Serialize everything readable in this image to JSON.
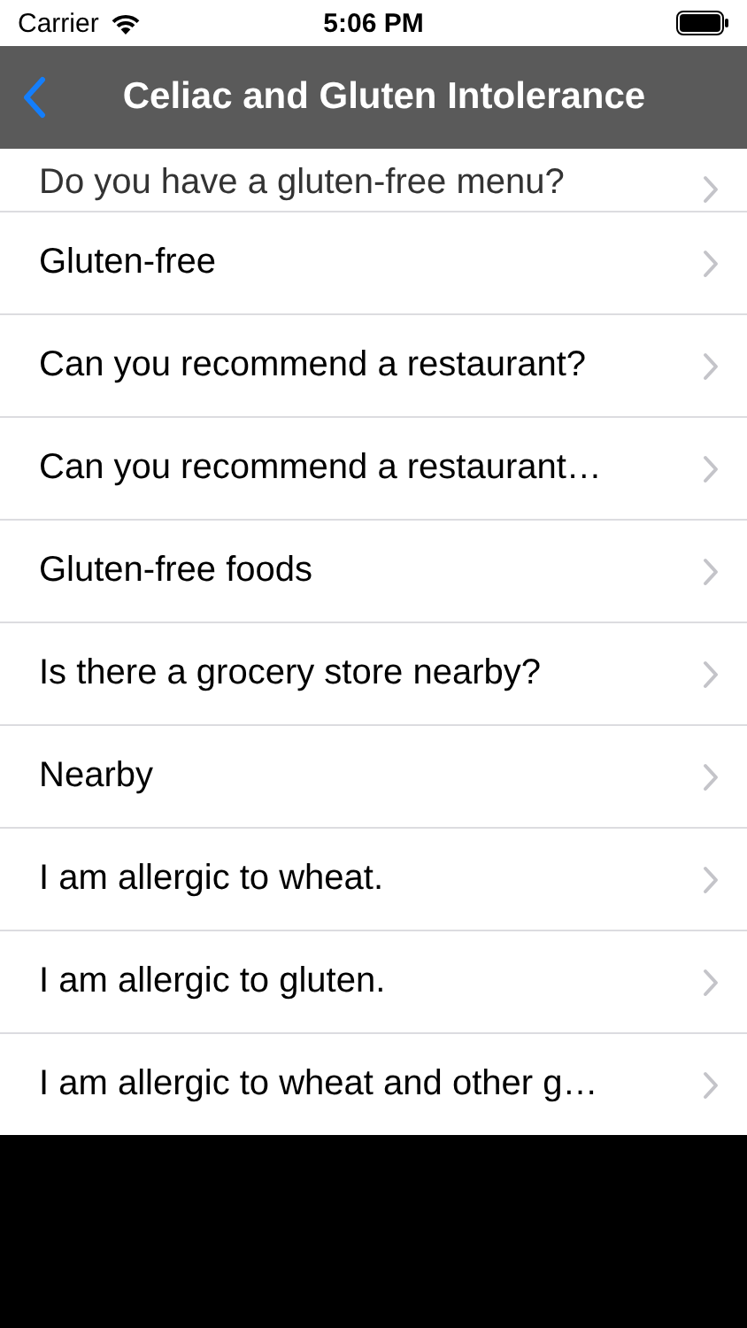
{
  "status_bar": {
    "carrier": "Carrier",
    "time": "5:06 PM"
  },
  "nav_bar": {
    "title": "Celiac and Gluten Intolerance"
  },
  "list": {
    "items": [
      {
        "label": "Do you have a gluten-free menu?",
        "partial": true
      },
      {
        "label": "Gluten-free",
        "partial": false
      },
      {
        "label": "Can you recommend a restaurant?",
        "partial": false
      },
      {
        "label": "Can you recommend a restaurant…",
        "partial": false
      },
      {
        "label": "Gluten-free foods",
        "partial": false
      },
      {
        "label": "Is there a grocery store nearby?",
        "partial": false
      },
      {
        "label": "Nearby",
        "partial": false
      },
      {
        "label": "I am allergic to wheat.",
        "partial": false
      },
      {
        "label": "I am allergic to gluten.",
        "partial": false
      },
      {
        "label": "I am allergic to wheat and other g…",
        "partial": false
      }
    ]
  }
}
